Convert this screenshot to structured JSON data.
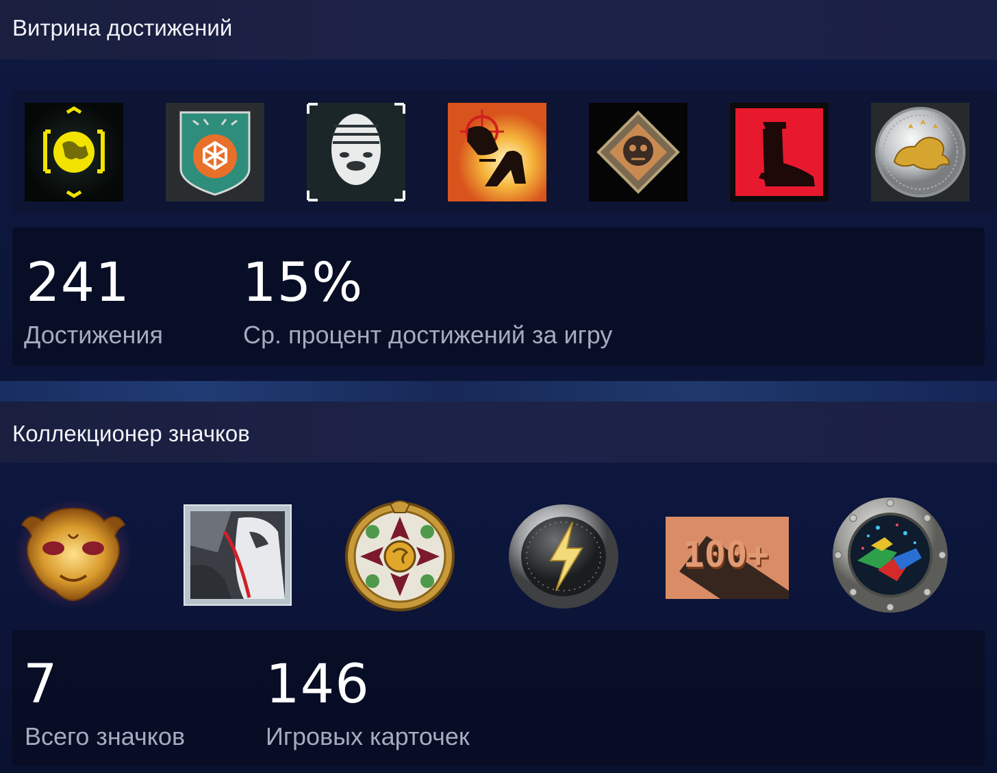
{
  "achievements": {
    "title": "Витрина достижений",
    "icons": [
      {
        "name": "globe-target-achievement-icon"
      },
      {
        "name": "shield-emblem-achievement-icon"
      },
      {
        "name": "clown-mask-achievement-icon"
      },
      {
        "name": "sniper-crosshair-achievement-icon"
      },
      {
        "name": "pirate-skull-emblem-achievement-icon"
      },
      {
        "name": "red-boot-achievement-icon"
      },
      {
        "name": "silver-lion-coin-achievement-icon"
      }
    ],
    "stats": [
      {
        "value": "241",
        "label": "Достижения"
      },
      {
        "value": "15%",
        "label": "Ср. процент достижений за игру"
      }
    ]
  },
  "badges": {
    "title": "Коллекционер значков",
    "icons": [
      {
        "name": "golden-mask-badge-icon"
      },
      {
        "name": "armor-knight-badge-icon"
      },
      {
        "name": "ornate-floral-medallion-badge-icon"
      },
      {
        "name": "lightning-coin-badge-icon"
      },
      {
        "name": "100-plus-badge-icon",
        "text": "100+"
      },
      {
        "name": "porthole-gems-badge-icon"
      }
    ],
    "stats": [
      {
        "value": "7",
        "label": "Всего значков"
      },
      {
        "value": "146",
        "label": "Игровых карточек"
      }
    ]
  },
  "colors": {
    "background": "#0c1538",
    "header": "#1b2045",
    "stat_label": "#a4acbf"
  }
}
